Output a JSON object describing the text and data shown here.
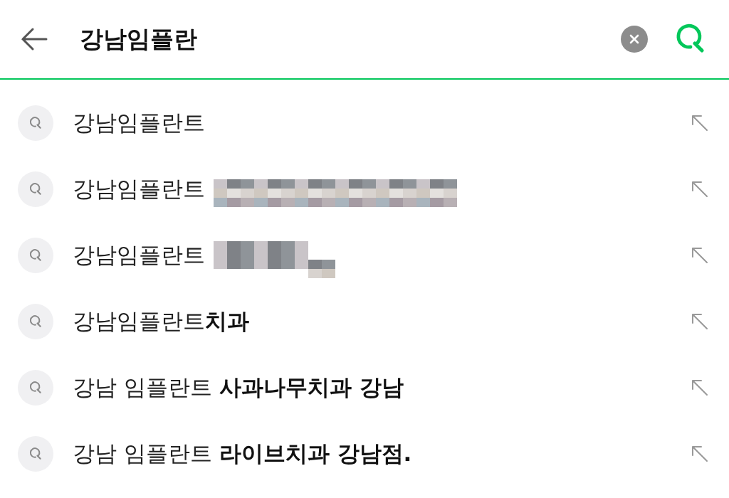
{
  "search_bar": {
    "value": "강남임플란"
  },
  "suggestions": [
    {
      "text": "강남임플란트"
    },
    {
      "text": "강남임플란트",
      "redacted": true,
      "wide": true
    },
    {
      "text": "강남임플란트",
      "redacted": true,
      "wide": false
    },
    {
      "text": "강남임플란트**치과**"
    },
    {
      "text": "강남 임플란트 **사과나무치과 강남**"
    },
    {
      "text": "강남 임플란트 **라이브치과 강남점.**"
    }
  ]
}
